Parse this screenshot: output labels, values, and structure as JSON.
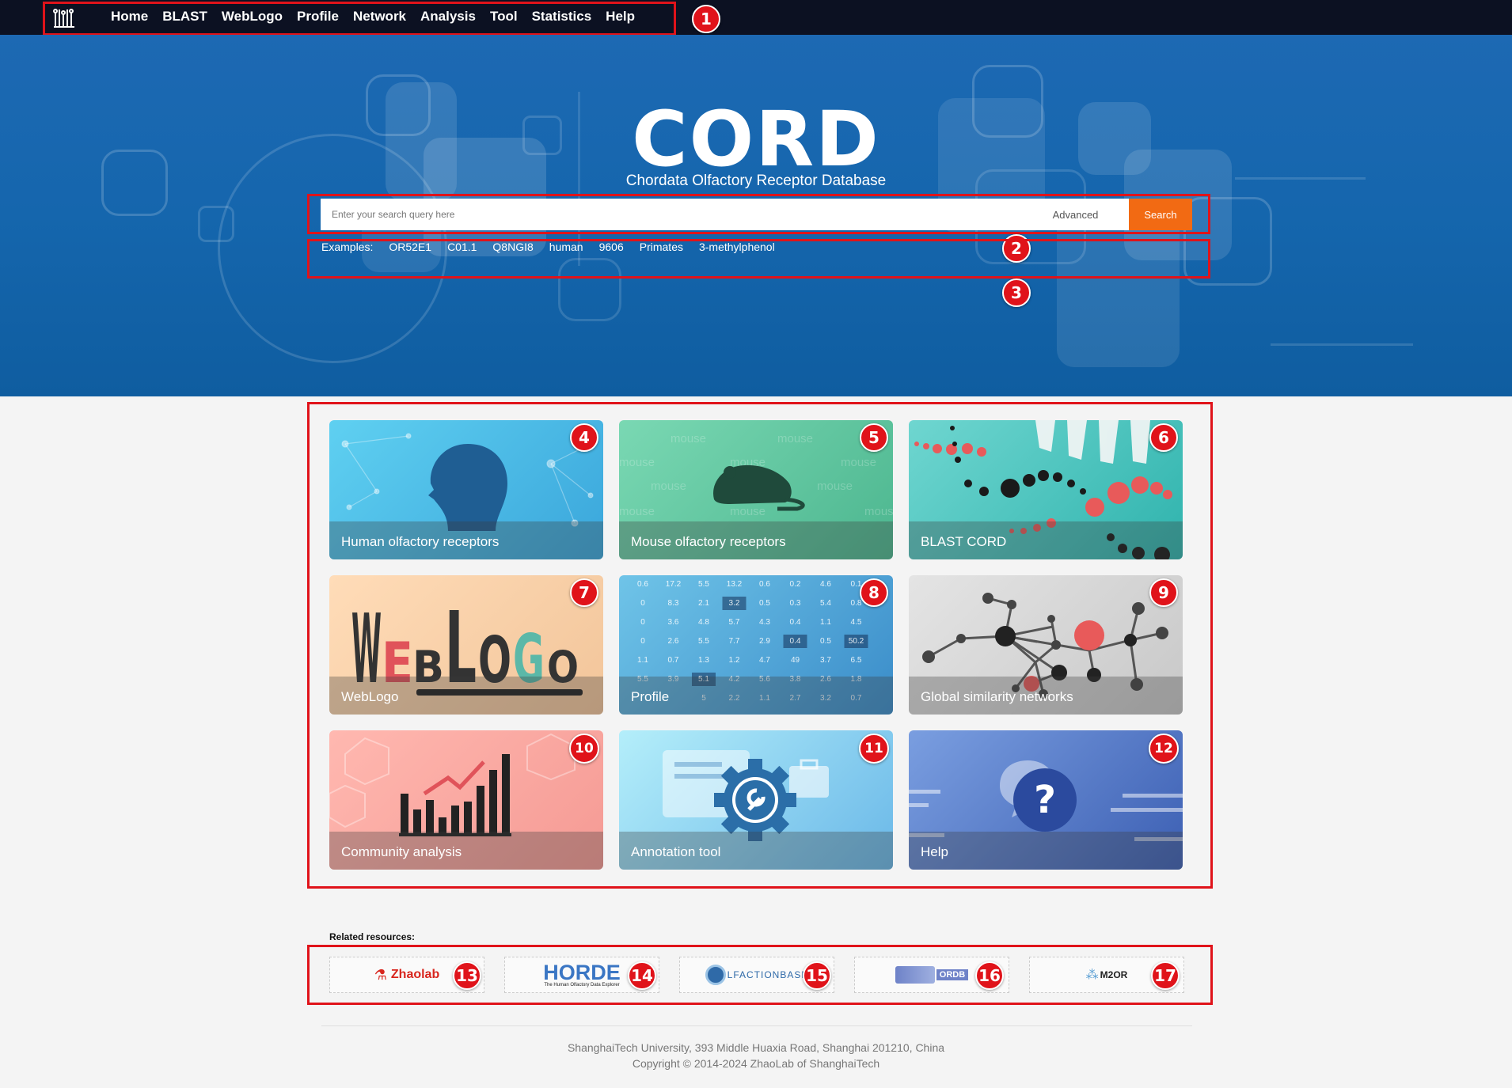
{
  "nav": {
    "items": [
      "Home",
      "BLAST",
      "WebLogo",
      "Profile",
      "Network",
      "Analysis",
      "Tool",
      "Statistics",
      "Help"
    ]
  },
  "hero": {
    "title": "CORD",
    "subtitle": "Chordata Olfactory Receptor Database"
  },
  "search": {
    "placeholder": "Enter your search query here",
    "advanced_label": "Advanced",
    "search_label": "Search"
  },
  "examples": {
    "label": "Examples:",
    "items": [
      "OR52E1",
      "C01.1",
      "Q8NGI8",
      "human",
      "9606",
      "Primates",
      "3-methylphenol"
    ]
  },
  "cards": [
    {
      "label": "Human olfactory receptors",
      "icon": "human-head-icon"
    },
    {
      "label": "Mouse olfactory receptors",
      "icon": "mouse-icon"
    },
    {
      "label": "BLAST CORD",
      "icon": "dna-icon"
    },
    {
      "label": "WebLogo",
      "icon": "weblogo-icon",
      "art": "WEBLOGO"
    },
    {
      "label": "Profile",
      "icon": "heatmap-icon"
    },
    {
      "label": "Global similarity networks",
      "icon": "network-icon"
    },
    {
      "label": "Community analysis",
      "icon": "bar-chart-icon"
    },
    {
      "label": "Annotation tool",
      "icon": "gear-wrench-icon"
    },
    {
      "label": "Help",
      "icon": "help-icon"
    }
  ],
  "profile_matrix": [
    [
      "0.6",
      "17.2",
      "5.5",
      "13.2",
      "0.6",
      "0.2",
      "4.6",
      "0.1"
    ],
    [
      "0",
      "8.3",
      "2.1",
      "3.2",
      "0.5",
      "0.3",
      "5.4",
      "0.8"
    ],
    [
      "0",
      "3.6",
      "4.8",
      "5.7",
      "4.3",
      "0.4",
      "1.1",
      "4.5"
    ],
    [
      "0",
      "2.6",
      "5.5",
      "7.7",
      "2.9",
      "0.4",
      "0.5",
      "50.2"
    ],
    [
      "1.1",
      "0.7",
      "1.3",
      "1.2",
      "4.7",
      "49",
      "3.7",
      "6.5"
    ],
    [
      "5.5",
      "3.9",
      "5.1",
      "4.2",
      "5.6",
      "3.8",
      "2.6",
      "1.8"
    ],
    [
      "",
      "",
      "5",
      "2.2",
      "1.1",
      "2.7",
      "3.2",
      "0.7"
    ]
  ],
  "mouse_watermark": "mouse",
  "resources": {
    "title": "Related resources:",
    "items": [
      {
        "name": "Zhaolab",
        "badge": "13"
      },
      {
        "name": "HORDE",
        "subtitle": "The Human Olfactory Data Explorer",
        "badge": "14"
      },
      {
        "name": "LFACTIONBASE",
        "badge": "15"
      },
      {
        "name": "ORDB",
        "badge": "16"
      },
      {
        "name": "M2OR",
        "badge": "17"
      }
    ]
  },
  "footer": {
    "address": "ShanghaiTech University, 393 Middle Huaxia Road, Shanghai 201210, China",
    "copyright": "Copyright © 2014-2024 ZhaoLab of ShanghaiTech"
  },
  "badges": [
    "1",
    "2",
    "3",
    "4",
    "5",
    "6",
    "7",
    "8",
    "9",
    "10",
    "11",
    "12",
    "13",
    "14",
    "15",
    "16",
    "17"
  ],
  "colors": {
    "annotation_red": "#e0131a",
    "search_orange": "#f26a13",
    "nav_bg": "#0c1122",
    "hero_blue": "#1566ad"
  }
}
